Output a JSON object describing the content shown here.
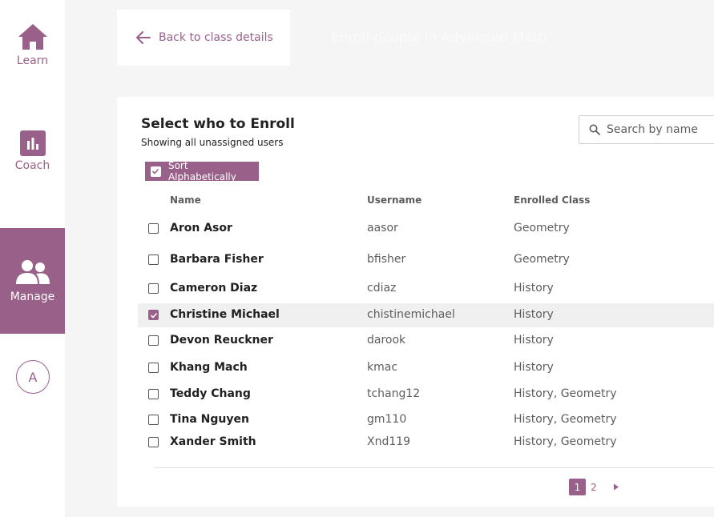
{
  "nav": {
    "learn_label": "Learn",
    "coach_label": "Coach",
    "manage_label": "Manage",
    "avatar_initial": "A"
  },
  "header": {
    "back_label": "Back to class details",
    "title": "Enroll people in Advanced Math"
  },
  "panel": {
    "title": "Select who to Enroll",
    "subtitle": "Showing all unassigned users",
    "search_placeholder": "Search by name",
    "sort_label": "Sort Alphabetically",
    "sort_checked": true
  },
  "table": {
    "headers": {
      "name": "Name",
      "username": "Username",
      "enrolled_class": "Enrolled Class"
    },
    "rows": [
      {
        "name": "Aron Asor",
        "username": "aasor",
        "enrolled_class": "Geometry",
        "checked": false
      },
      {
        "name": "Barbara Fisher",
        "username": "bfisher",
        "enrolled_class": "Geometry",
        "checked": false
      },
      {
        "name": "Cameron Diaz",
        "username": "cdiaz",
        "enrolled_class": "History",
        "checked": false
      },
      {
        "name": "Christine Michael",
        "username": "chistinemichael",
        "enrolled_class": "History",
        "checked": true
      },
      {
        "name": "Devon Reuckner",
        "username": "darook",
        "enrolled_class": "History",
        "checked": false
      },
      {
        "name": "Khang Mach",
        "username": "kmac",
        "enrolled_class": "History",
        "checked": false
      },
      {
        "name": "Teddy Chang",
        "username": "tchang12",
        "enrolled_class": "History, Geometry",
        "checked": false
      },
      {
        "name": "Tina Nguyen",
        "username": "gm110",
        "enrolled_class": "History, Geometry",
        "checked": false
      },
      {
        "name": "Xander Smith",
        "username": "Xnd119",
        "enrolled_class": "History, Geometry",
        "checked": false
      }
    ]
  },
  "pagination": {
    "current": "1",
    "next_page": "2",
    "next_icon": "chevron-right-icon"
  },
  "colors": {
    "accent": "#996189",
    "background": "#f5f5f5",
    "card": "#ffffff"
  }
}
